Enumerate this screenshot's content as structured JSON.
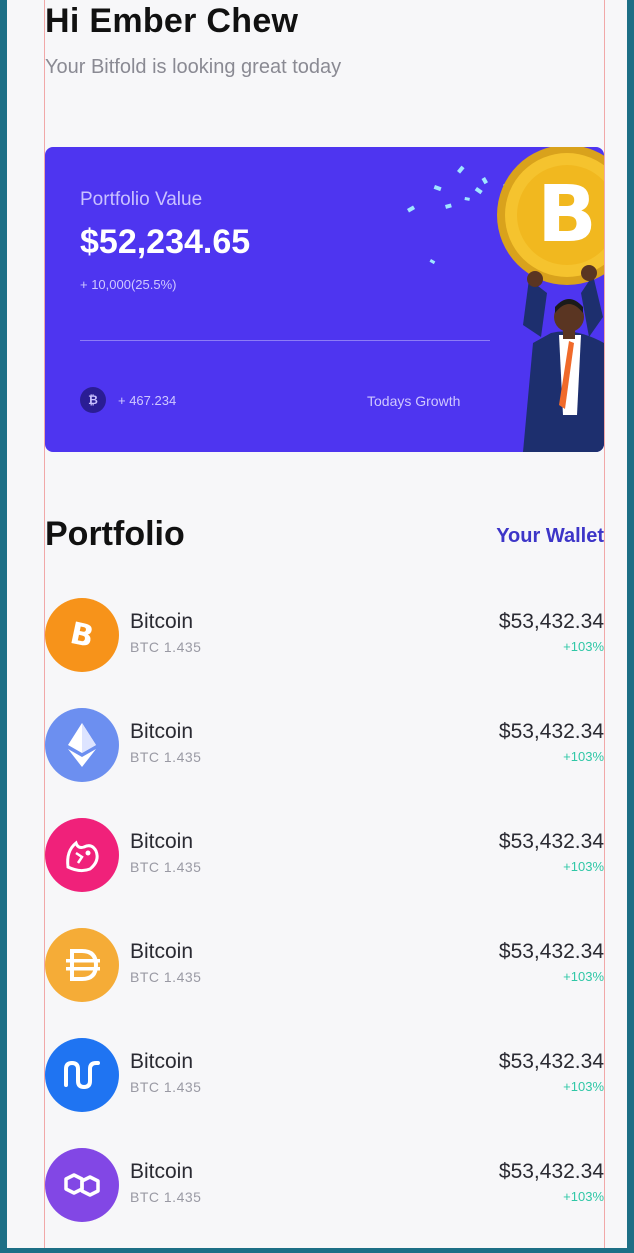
{
  "greeting": {
    "title": "Hi Ember Chew",
    "subtitle": "Your Bitfold is looking great today"
  },
  "portfolio_card": {
    "label": "Portfolio Value",
    "value": "$52,234.65",
    "change": "+ 10,000(25.5%)",
    "growth_value": "+ 467.234",
    "growth_label": "Todays Growth",
    "background": "#4e35f0"
  },
  "portfolio_section": {
    "title": "Portfolio",
    "wallet_link": "Your Wallet"
  },
  "assets": [
    {
      "name": "Bitcoin",
      "sub": "BTC 1.435",
      "value": "$53,432.34",
      "change": "+103%",
      "icon": "bitcoin-icon",
      "color": "#f7931a"
    },
    {
      "name": "Bitcoin",
      "sub": "BTC 1.435",
      "value": "$53,432.34",
      "change": "+103%",
      "icon": "ethereum-icon",
      "color": "#6c8ff0"
    },
    {
      "name": "Bitcoin",
      "sub": "BTC 1.435",
      "value": "$53,432.34",
      "change": "+103%",
      "icon": "uniswap-icon",
      "color": "#f0217a"
    },
    {
      "name": "Bitcoin",
      "sub": "BTC 1.435",
      "value": "$53,432.34",
      "change": "+103%",
      "icon": "dai-icon",
      "color": "#f5ac37"
    },
    {
      "name": "Bitcoin",
      "sub": "BTC 1.435",
      "value": "$53,432.34",
      "change": "+103%",
      "icon": "nano-icon",
      "color": "#1f74f2"
    },
    {
      "name": "Bitcoin",
      "sub": "BTC 1.435",
      "value": "$53,432.34",
      "change": "+103%",
      "icon": "polygon-icon",
      "color": "#8247e5"
    }
  ],
  "colors": {
    "accent": "#4e35f0",
    "positive": "#2fc7a6",
    "link": "#3d35c8"
  }
}
